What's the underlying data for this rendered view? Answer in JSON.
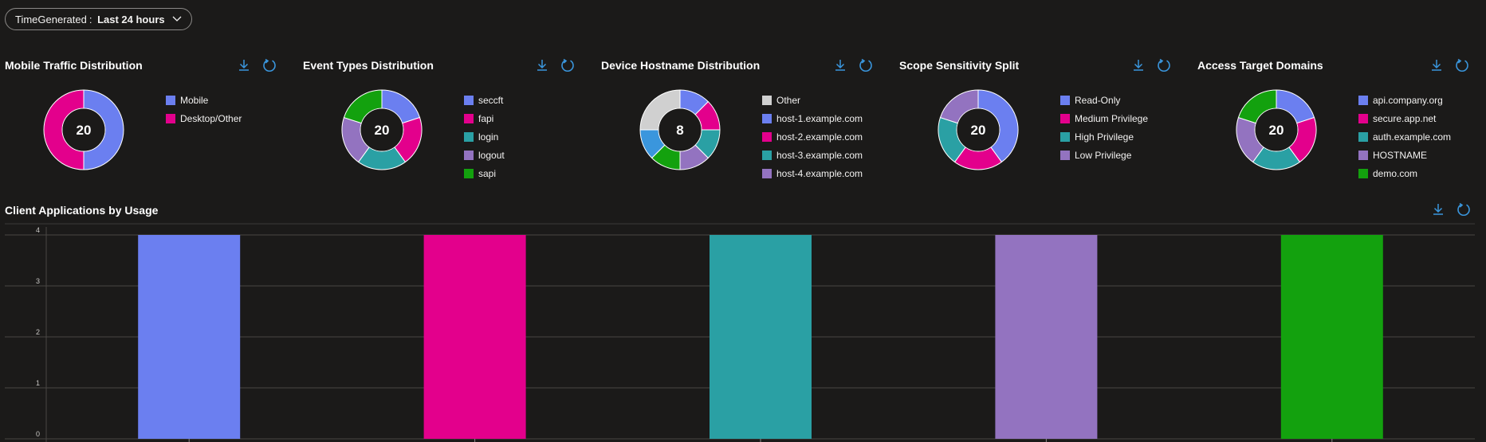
{
  "filter": {
    "key": "TimeGenerated",
    "separator": ": ",
    "value": "Last 24 hours"
  },
  "tiles": [
    {
      "title": "Mobile Traffic Distribution",
      "total": "20",
      "legend": [
        {
          "label": "Mobile",
          "color": "#6b7ff0"
        },
        {
          "label": "Desktop/Other",
          "color": "#e3008c"
        }
      ],
      "values": [
        10,
        10
      ]
    },
    {
      "title": "Event Types Distribution",
      "total": "20",
      "legend": [
        {
          "label": "seccft",
          "color": "#6b7ff0"
        },
        {
          "label": "fapi",
          "color": "#e3008c"
        },
        {
          "label": "login",
          "color": "#2aa0a4"
        },
        {
          "label": "logout",
          "color": "#9373c0"
        },
        {
          "label": "sapi",
          "color": "#13a10e"
        }
      ],
      "values": [
        4,
        4,
        4,
        4,
        4
      ]
    },
    {
      "title": "Device Hostname Distribution",
      "total": "8",
      "legend": [
        {
          "label": "Other",
          "color": "#d0d0d0"
        },
        {
          "label": "host-1.example.com",
          "color": "#6b7ff0"
        },
        {
          "label": "host-2.example.com",
          "color": "#e3008c"
        },
        {
          "label": "host-3.example.com",
          "color": "#2aa0a4"
        },
        {
          "label": "host-4.example.com",
          "color": "#9373c0"
        }
      ],
      "values": [
        1,
        1,
        1,
        1,
        1,
        1,
        2
      ],
      "slice_colors": [
        "#6b7ff0",
        "#e3008c",
        "#2aa0a4",
        "#9373c0",
        "#13a10e",
        "#3a96dd",
        "#d0d0d0"
      ]
    },
    {
      "title": "Scope Sensitivity Split",
      "total": "20",
      "legend": [
        {
          "label": "Read-Only",
          "color": "#6b7ff0"
        },
        {
          "label": "Medium Privilege",
          "color": "#e3008c"
        },
        {
          "label": "High Privilege",
          "color": "#2aa0a4"
        },
        {
          "label": "Low Privilege",
          "color": "#9373c0"
        }
      ],
      "values": [
        8,
        4,
        4,
        4
      ]
    },
    {
      "title": "Access Target Domains",
      "total": "20",
      "legend": [
        {
          "label": "api.company.org",
          "color": "#6b7ff0"
        },
        {
          "label": "secure.app.net",
          "color": "#e3008c"
        },
        {
          "label": "auth.example.com",
          "color": "#2aa0a4"
        },
        {
          "label": "HOSTNAME",
          "color": "#9373c0"
        },
        {
          "label": "demo.com",
          "color": "#13a10e"
        }
      ],
      "values": [
        4,
        4,
        4,
        4,
        4
      ]
    }
  ],
  "bar_chart": {
    "title": "Client Applications by Usage"
  },
  "chart_data": {
    "type": "bar",
    "title": "Client Applications by Usage",
    "categories": [
      "",
      "",
      "",
      "",
      ""
    ],
    "values": [
      4,
      4,
      4,
      4,
      4
    ],
    "colors": [
      "#6b7ff0",
      "#e3008c",
      "#2aa0a4",
      "#9373c0",
      "#13a10e"
    ],
    "ylim": [
      0,
      4
    ],
    "yticks": [
      "0",
      "1",
      "2",
      "3",
      "4"
    ],
    "grid": true
  },
  "icons": {
    "download": "download-icon",
    "refresh": "refresh-icon",
    "chevron": "chevron-down-icon"
  }
}
